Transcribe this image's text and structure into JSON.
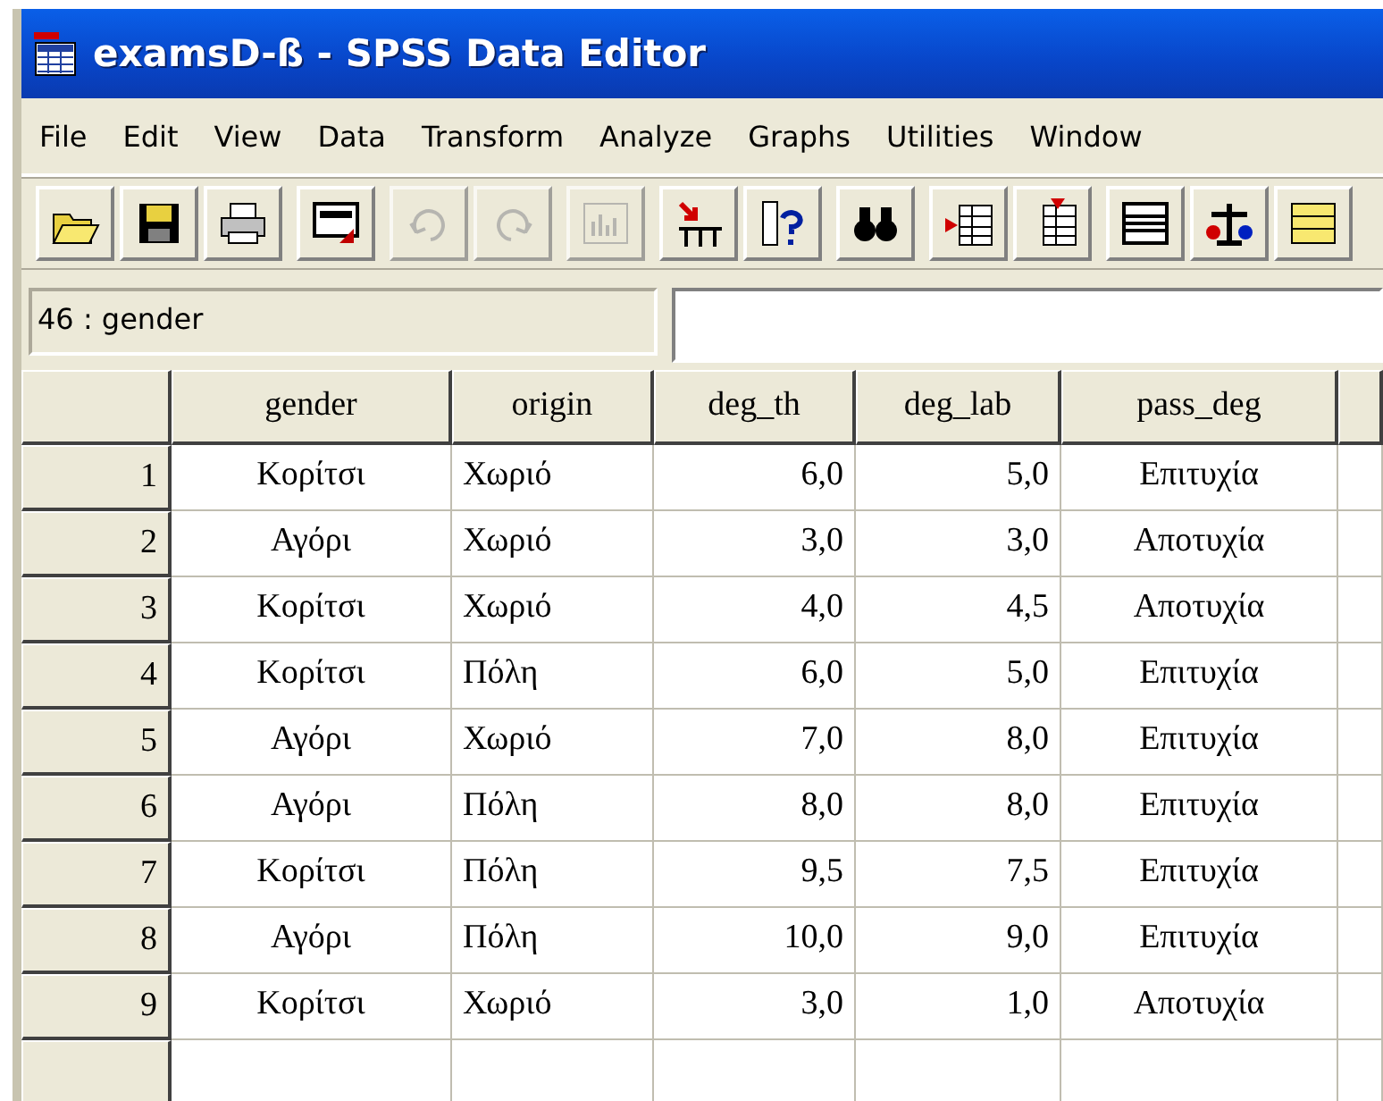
{
  "window": {
    "title": "examsD-ß - SPSS Data Editor"
  },
  "menu": [
    "File",
    "Edit",
    "View",
    "Data",
    "Transform",
    "Analyze",
    "Graphs",
    "Utilities",
    "Window"
  ],
  "toolbar": [
    [
      {
        "kind": "open",
        "disabled": false
      },
      {
        "kind": "save",
        "disabled": false
      },
      {
        "kind": "print",
        "disabled": false
      }
    ],
    [
      {
        "kind": "dialog",
        "disabled": false
      }
    ],
    [
      {
        "kind": "undo",
        "disabled": true
      },
      {
        "kind": "redo",
        "disabled": true
      }
    ],
    [
      {
        "kind": "chart",
        "disabled": true
      }
    ],
    [
      {
        "kind": "goto",
        "disabled": false
      },
      {
        "kind": "variables",
        "disabled": false
      }
    ],
    [
      {
        "kind": "find",
        "disabled": false
      }
    ],
    [
      {
        "kind": "insert_case",
        "disabled": false
      },
      {
        "kind": "insert_variable",
        "disabled": false
      }
    ],
    [
      {
        "kind": "split",
        "disabled": false
      },
      {
        "kind": "weight",
        "disabled": false
      },
      {
        "kind": "select",
        "disabled": false
      }
    ]
  ],
  "cell_reference": "46 : gender",
  "table": {
    "columns": [
      {
        "name": "gender"
      },
      {
        "name": "origin"
      },
      {
        "name": "deg_th"
      },
      {
        "name": "deg_lab"
      },
      {
        "name": "pass_deg"
      }
    ],
    "rows": [
      {
        "case": "1",
        "cells": [
          "Κορίτσι",
          "Χωριό",
          "6,0",
          "5,0",
          "Επιτυχία"
        ]
      },
      {
        "case": "2",
        "cells": [
          "Αγόρι",
          "Χωριό",
          "3,0",
          "3,0",
          "Αποτυχία"
        ]
      },
      {
        "case": "3",
        "cells": [
          "Κορίτσι",
          "Χωριό",
          "4,0",
          "4,5",
          "Αποτυχία"
        ]
      },
      {
        "case": "4",
        "cells": [
          "Κορίτσι",
          "Πόλη",
          "6,0",
          "5,0",
          "Επιτυχία"
        ]
      },
      {
        "case": "5",
        "cells": [
          "Αγόρι",
          "Χωριό",
          "7,0",
          "8,0",
          "Επιτυχία"
        ]
      },
      {
        "case": "6",
        "cells": [
          "Αγόρι",
          "Πόλη",
          "8,0",
          "8,0",
          "Επιτυχία"
        ]
      },
      {
        "case": "7",
        "cells": [
          "Κορίτσι",
          "Πόλη",
          "9,5",
          "7,5",
          "Επιτυχία"
        ]
      },
      {
        "case": "8",
        "cells": [
          "Αγόρι",
          "Πόλη",
          "10,0",
          "9,0",
          "Επιτυχία"
        ]
      },
      {
        "case": "9",
        "cells": [
          "Κορίτσι",
          "Χωριό",
          "3,0",
          "1,0",
          "Αποτυχία"
        ]
      }
    ]
  }
}
